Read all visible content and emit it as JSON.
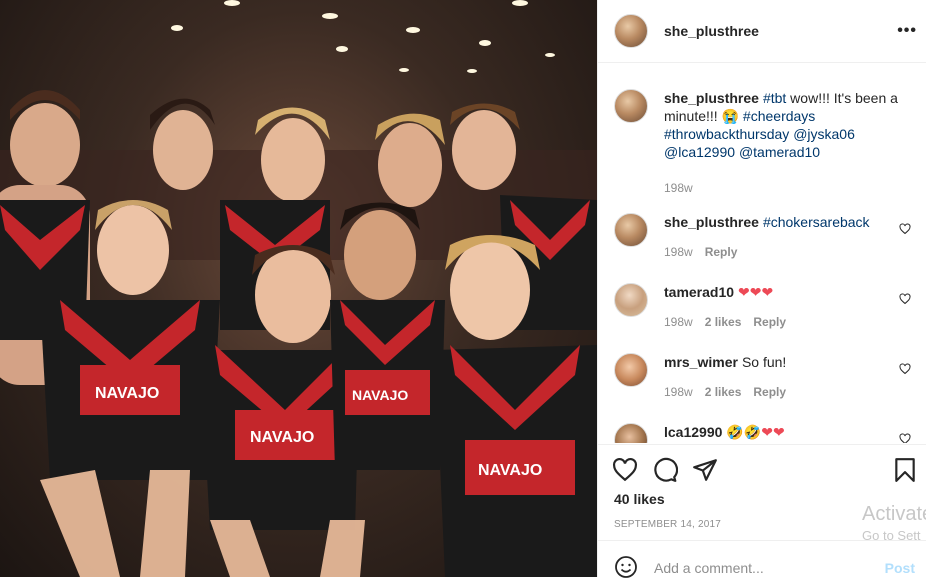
{
  "post": {
    "username": "she_plusthree",
    "more_label": "•••"
  },
  "caption": {
    "username": "she_plusthree",
    "text_1": "#tbt",
    "text_2": " wow!!! It's been a minute!!! ",
    "emoji": "😭",
    "text_3": " ",
    "hashtag_1": "#cheerdays",
    "hashtag_2": "#throwbackthursday",
    "mention_1": "@jyska06",
    "mention_2": "@lca12990",
    "mention_3": "@tamerad10",
    "time": "198w"
  },
  "comments": [
    {
      "username": "she_plusthree",
      "text": "#chokersareback",
      "time": "198w",
      "likes": "",
      "reply": "Reply"
    },
    {
      "username": "tamerad10",
      "text": "❤❤❤",
      "time": "198w",
      "likes": "2 likes",
      "reply": "Reply"
    },
    {
      "username": "mrs_wimer",
      "text": "So fun!",
      "time": "198w",
      "likes": "2 likes",
      "reply": "Reply"
    },
    {
      "username": "lca12990",
      "text": "🤣🤣❤❤",
      "time": "",
      "likes": "",
      "reply": ""
    }
  ],
  "actions": {
    "likes": "40 likes",
    "date": "SEPTEMBER 14, 2017"
  },
  "add_comment": {
    "placeholder": "Add a comment...",
    "post": "Post"
  },
  "watermark": {
    "line1": "Activate",
    "line2": "Go to Sett"
  },
  "photo": {
    "jersey_text": "NAVAJO"
  },
  "colors": {
    "link": "#00376b",
    "muted": "#8e8e8e",
    "text": "#262626",
    "heart": "#ed4956",
    "post_disabled": "#b2dffc"
  }
}
